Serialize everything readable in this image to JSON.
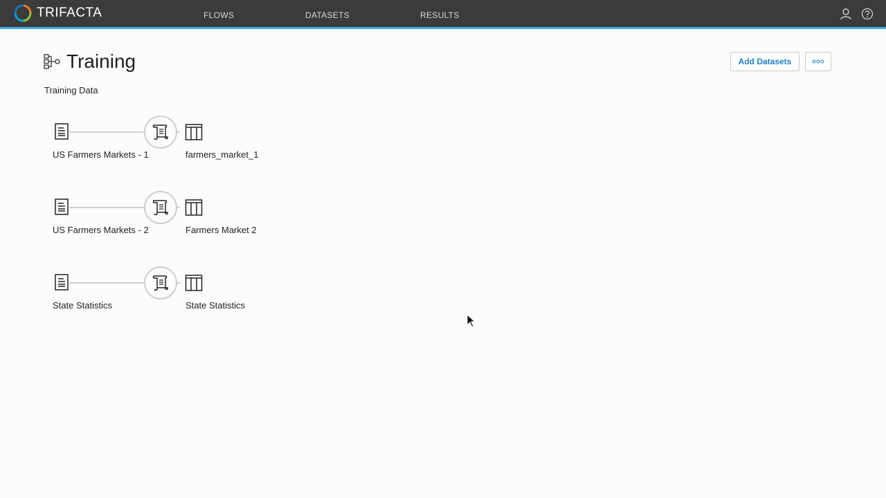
{
  "app": {
    "logo_text": "TRIFACTA",
    "accent_color": "#3fa8e3",
    "topbar_color": "#3b3b3b"
  },
  "nav": {
    "items": [
      {
        "label": "FLOWS"
      },
      {
        "label": "DATASETS"
      },
      {
        "label": "RESULTS"
      }
    ],
    "icons": [
      "user-icon",
      "help-icon"
    ]
  },
  "page": {
    "title": "Training",
    "description": "Training Data",
    "add_datasets_label": "Add Datasets",
    "more_label": "ooo"
  },
  "flows": [
    {
      "source": "US Farmers Markets - 1",
      "output": "farmers_market_1"
    },
    {
      "source": "US Farmers Markets - 2",
      "output": "Farmers Market 2"
    },
    {
      "source": "State Statistics",
      "output": "State Statistics"
    }
  ]
}
